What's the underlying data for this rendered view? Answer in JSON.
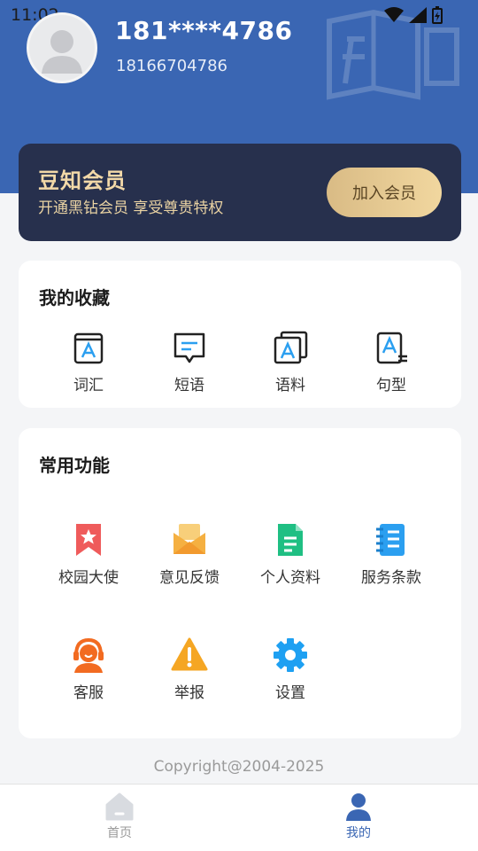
{
  "status_bar": {
    "time": "11:02"
  },
  "profile": {
    "display_name": "181****4786",
    "phone": "18166704786"
  },
  "vip": {
    "title": "豆知会员",
    "subtitle": "开通黑钻会员 享受尊贵特权",
    "join_label": "加入会员"
  },
  "favorites": {
    "title": "我的收藏",
    "items": [
      {
        "label": "词汇",
        "icon": "vocabulary-icon"
      },
      {
        "label": "短语",
        "icon": "phrase-icon"
      },
      {
        "label": "语料",
        "icon": "corpus-icon"
      },
      {
        "label": "句型",
        "icon": "sentence-pattern-icon"
      }
    ]
  },
  "functions": {
    "title": "常用功能",
    "items": [
      {
        "label": "校园大使",
        "icon": "bookmark-star-icon",
        "color": "#ef5b5b"
      },
      {
        "label": "意见反馈",
        "icon": "envelope-icon",
        "color": "#f5b041"
      },
      {
        "label": "个人资料",
        "icon": "document-icon",
        "color": "#1fbf83"
      },
      {
        "label": "服务条款",
        "icon": "notebook-icon",
        "color": "#2b9ff0"
      },
      {
        "label": "客服",
        "icon": "headset-icon",
        "color": "#f26b21"
      },
      {
        "label": "举报",
        "icon": "warning-icon",
        "color": "#f5a623"
      },
      {
        "label": "设置",
        "icon": "gear-icon",
        "color": "#1ea0f2"
      }
    ]
  },
  "copyright": "Copyright@2004-2025",
  "tabbar": {
    "home_label": "首页",
    "mine_label": "我的"
  },
  "colors": {
    "header": "#3a66b3",
    "vip_card": "#27304d",
    "vip_gold": "#f3d9a8"
  }
}
